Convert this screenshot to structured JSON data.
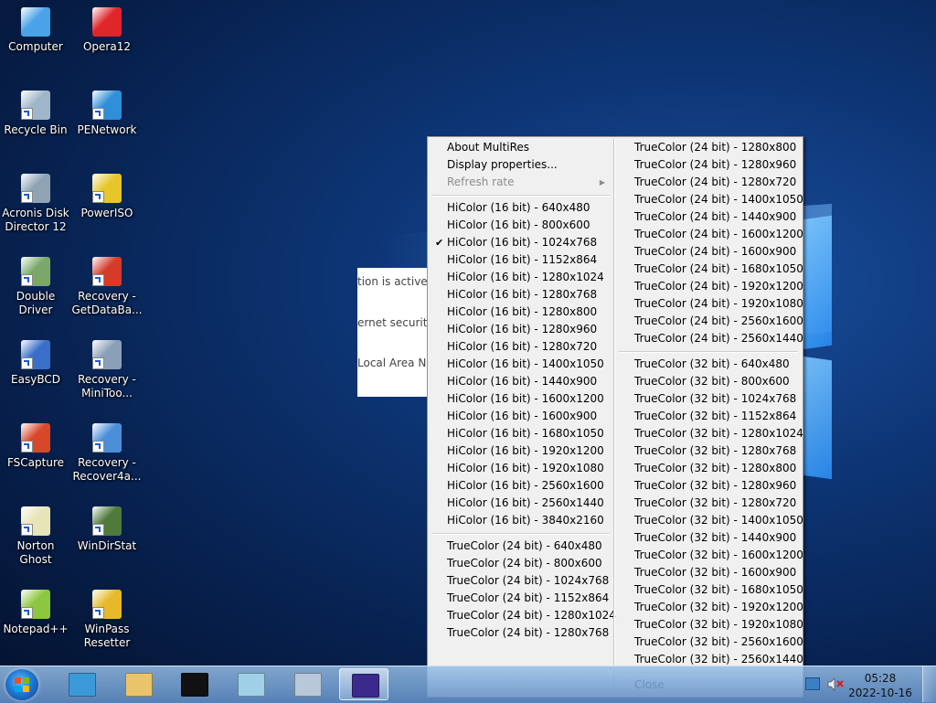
{
  "desktop": {
    "icons": [
      {
        "label": "Computer",
        "icon": "computer-icon",
        "color": "#4aa3e8"
      },
      {
        "label": "Opera12",
        "icon": "opera-icon",
        "color": "#e0262a"
      },
      {
        "label": "Recycle Bin",
        "icon": "recycle-bin-icon",
        "color": "#9fb6c9"
      },
      {
        "label": "PENetwork",
        "icon": "network-icon",
        "color": "#2f8fd8"
      },
      {
        "label": "Acronis Disk Director 12",
        "icon": "acronis-icon",
        "color": "#8fa3b5"
      },
      {
        "label": "PowerISO",
        "icon": "poweriso-icon",
        "color": "#e6c62a"
      },
      {
        "label": "Double Driver",
        "icon": "double-driver-icon",
        "color": "#7aa86a"
      },
      {
        "label": "Recovery - GetDataBa...",
        "icon": "getdataback-icon",
        "color": "#d63a2a"
      },
      {
        "label": "EasyBCD",
        "icon": "easybcd-icon",
        "color": "#3a6fc9"
      },
      {
        "label": "Recovery - MiniToo...",
        "icon": "minitool-icon",
        "color": "#8aa0b8"
      },
      {
        "label": "FSCapture",
        "icon": "fscapture-icon",
        "color": "#d9472b"
      },
      {
        "label": "Recovery - Recover4a...",
        "icon": "recover4all-icon",
        "color": "#4b8fd9"
      },
      {
        "label": "Norton Ghost",
        "icon": "norton-ghost-icon",
        "color": "#e7e4b8"
      },
      {
        "label": "WinDirStat",
        "icon": "windirstat-icon",
        "color": "#4f7a3a"
      },
      {
        "label": "Notepad++",
        "icon": "notepadpp-icon",
        "color": "#8dc63f"
      },
      {
        "label": "WinPass Resetter",
        "icon": "key-icon",
        "color": "#e7b92a"
      }
    ]
  },
  "background_dialog": {
    "lines": [
      "tion is active",
      "ernet security",
      "Local Area N"
    ]
  },
  "context_menu": {
    "left_items": [
      {
        "label": "About MultiRes",
        "type": "item"
      },
      {
        "label": "Display properties...",
        "type": "item"
      },
      {
        "label": "Refresh rate",
        "type": "submenu",
        "disabled": true
      },
      {
        "type": "separator"
      },
      {
        "label": "HiColor (16 bit) - 640x480",
        "type": "item"
      },
      {
        "label": "HiColor (16 bit) - 800x600",
        "type": "item"
      },
      {
        "label": "HiColor (16 bit) - 1024x768",
        "type": "item",
        "checked": true
      },
      {
        "label": "HiColor (16 bit) - 1152x864",
        "type": "item"
      },
      {
        "label": "HiColor (16 bit) - 1280x1024",
        "type": "item"
      },
      {
        "label": "HiColor (16 bit) - 1280x768",
        "type": "item"
      },
      {
        "label": "HiColor (16 bit) - 1280x800",
        "type": "item"
      },
      {
        "label": "HiColor (16 bit) - 1280x960",
        "type": "item"
      },
      {
        "label": "HiColor (16 bit) - 1280x720",
        "type": "item"
      },
      {
        "label": "HiColor (16 bit) - 1400x1050",
        "type": "item"
      },
      {
        "label": "HiColor (16 bit) - 1440x900",
        "type": "item"
      },
      {
        "label": "HiColor (16 bit) - 1600x1200",
        "type": "item"
      },
      {
        "label": "HiColor (16 bit) - 1600x900",
        "type": "item"
      },
      {
        "label": "HiColor (16 bit) - 1680x1050",
        "type": "item"
      },
      {
        "label": "HiColor (16 bit) - 1920x1200",
        "type": "item"
      },
      {
        "label": "HiColor (16 bit) - 1920x1080",
        "type": "item"
      },
      {
        "label": "HiColor (16 bit) - 2560x1600",
        "type": "item"
      },
      {
        "label": "HiColor (16 bit) - 2560x1440",
        "type": "item"
      },
      {
        "label": "HiColor (16 bit) - 3840x2160",
        "type": "item"
      },
      {
        "type": "separator"
      },
      {
        "label": "TrueColor (24 bit) - 640x480",
        "type": "item"
      },
      {
        "label": "TrueColor (24 bit) - 800x600",
        "type": "item"
      },
      {
        "label": "TrueColor (24 bit) - 1024x768",
        "type": "item"
      },
      {
        "label": "TrueColor (24 bit) - 1152x864",
        "type": "item"
      },
      {
        "label": "TrueColor (24 bit) - 1280x1024",
        "type": "item"
      },
      {
        "label": "TrueColor (24 bit) - 1280x768",
        "type": "item"
      }
    ],
    "right_items": [
      {
        "label": "TrueColor (24 bit) - 1280x800",
        "type": "item"
      },
      {
        "label": "TrueColor (24 bit) - 1280x960",
        "type": "item"
      },
      {
        "label": "TrueColor (24 bit) - 1280x720",
        "type": "item"
      },
      {
        "label": "TrueColor (24 bit) - 1400x1050",
        "type": "item"
      },
      {
        "label": "TrueColor (24 bit) - 1440x900",
        "type": "item"
      },
      {
        "label": "TrueColor (24 bit) - 1600x1200",
        "type": "item"
      },
      {
        "label": "TrueColor (24 bit) - 1600x900",
        "type": "item"
      },
      {
        "label": "TrueColor (24 bit) - 1680x1050",
        "type": "item"
      },
      {
        "label": "TrueColor (24 bit) - 1920x1200",
        "type": "item"
      },
      {
        "label": "TrueColor (24 bit) - 1920x1080",
        "type": "item"
      },
      {
        "label": "TrueColor (24 bit) - 2560x1600",
        "type": "item"
      },
      {
        "label": "TrueColor (24 bit) - 2560x1440",
        "type": "item"
      },
      {
        "type": "separator"
      },
      {
        "label": "TrueColor (32 bit) - 640x480",
        "type": "item"
      },
      {
        "label": "TrueColor (32 bit) - 800x600",
        "type": "item"
      },
      {
        "label": "TrueColor (32 bit) - 1024x768",
        "type": "item"
      },
      {
        "label": "TrueColor (32 bit) - 1152x864",
        "type": "item"
      },
      {
        "label": "TrueColor (32 bit) - 1280x1024",
        "type": "item"
      },
      {
        "label": "TrueColor (32 bit) - 1280x768",
        "type": "item"
      },
      {
        "label": "TrueColor (32 bit) - 1280x800",
        "type": "item"
      },
      {
        "label": "TrueColor (32 bit) - 1280x960",
        "type": "item"
      },
      {
        "label": "TrueColor (32 bit) - 1280x720",
        "type": "item"
      },
      {
        "label": "TrueColor (32 bit) - 1400x1050",
        "type": "item"
      },
      {
        "label": "TrueColor (32 bit) - 1440x900",
        "type": "item"
      },
      {
        "label": "TrueColor (32 bit) - 1600x1200",
        "type": "item"
      },
      {
        "label": "TrueColor (32 bit) - 1600x900",
        "type": "item"
      },
      {
        "label": "TrueColor (32 bit) - 1680x1050",
        "type": "item"
      },
      {
        "label": "TrueColor (32 bit) - 1920x1200",
        "type": "item"
      },
      {
        "label": "TrueColor (32 bit) - 1920x1080",
        "type": "item"
      },
      {
        "label": "TrueColor (32 bit) - 2560x1600",
        "type": "item"
      },
      {
        "label": "TrueColor (32 bit) - 2560x1440",
        "type": "item"
      },
      {
        "type": "separator"
      },
      {
        "label": "Close",
        "type": "item"
      }
    ]
  },
  "taskbar": {
    "buttons": [
      {
        "icon": "pe-network-monitor-icon",
        "color": "#3a9ad9"
      },
      {
        "icon": "file-explorer-icon",
        "color": "#e9c46a"
      },
      {
        "icon": "command-prompt-icon",
        "color": "#111111"
      },
      {
        "icon": "notepad-icon",
        "color": "#9fd0e8"
      },
      {
        "icon": "calculator-icon",
        "color": "#b8c8d8"
      },
      {
        "icon": "multires-icon",
        "color": "#3b2a8c",
        "active": true
      }
    ],
    "tray": {
      "icons": [
        "network-tray-icon",
        "volume-muted-icon"
      ],
      "time": "05:28",
      "date": "2022-10-16"
    }
  }
}
